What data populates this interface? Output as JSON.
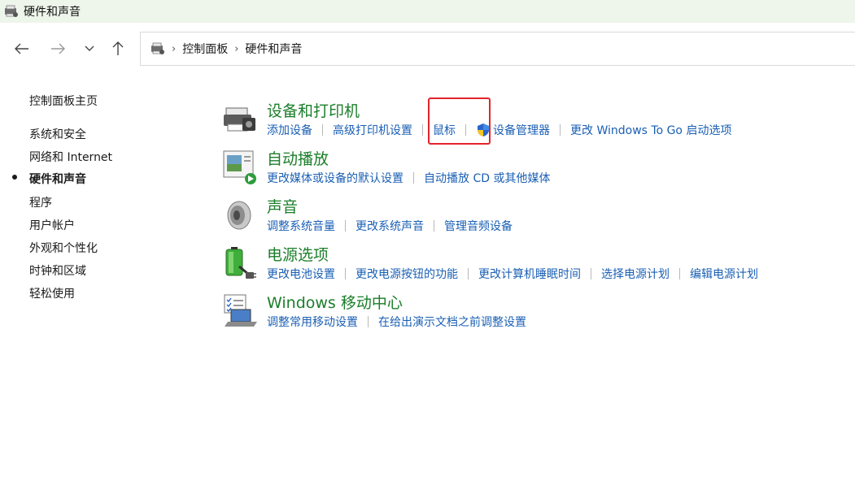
{
  "window": {
    "title": "硬件和声音"
  },
  "breadcrumb": [
    "控制面板",
    "硬件和声音"
  ],
  "sidebar": {
    "home": "控制面板主页",
    "items": [
      {
        "label": "系统和安全",
        "active": false
      },
      {
        "label": "网络和 Internet",
        "active": false
      },
      {
        "label": "硬件和声音",
        "active": true
      },
      {
        "label": "程序",
        "active": false
      },
      {
        "label": "用户帐户",
        "active": false
      },
      {
        "label": "外观和个性化",
        "active": false
      },
      {
        "label": "时钟和区域",
        "active": false
      },
      {
        "label": "轻松使用",
        "active": false
      }
    ]
  },
  "categories": [
    {
      "title": "设备和打印机",
      "icon": "printer-icon",
      "links": [
        "添加设备",
        "高级打印机设置",
        "鼠标",
        "设备管理器",
        "更改 Windows To Go 启动选项"
      ]
    },
    {
      "title": "自动播放",
      "icon": "autoplay-icon",
      "links": [
        "更改媒体或设备的默认设置",
        "自动播放 CD 或其他媒体"
      ]
    },
    {
      "title": "声音",
      "icon": "speaker-icon",
      "links": [
        "调整系统音量",
        "更改系统声音",
        "管理音频设备"
      ]
    },
    {
      "title": "电源选项",
      "icon": "battery-plug-icon",
      "links": [
        "更改电池设置",
        "更改电源按钮的功能",
        "更改计算机睡眠时间",
        "选择电源计划",
        "编辑电源计划"
      ]
    },
    {
      "title": "Windows 移动中心",
      "icon": "laptop-checklist-icon",
      "links": [
        "调整常用移动设置",
        "在给出演示文档之前调整设置"
      ]
    }
  ],
  "colors": {
    "category_title": "#1b7e2a",
    "link": "#1a5fb4",
    "highlight": "#e3242b",
    "titlebar_bg": "#eef5ea"
  }
}
